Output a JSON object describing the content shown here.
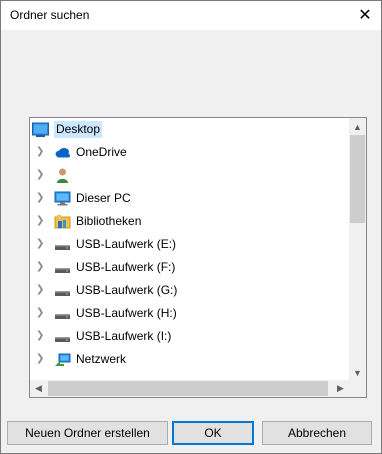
{
  "window": {
    "title": "Ordner suchen",
    "close_glyph": "✕"
  },
  "tree": {
    "items": [
      {
        "label": "Desktop",
        "icon": "desktop-icon",
        "selected": true,
        "expander": false
      },
      {
        "label": "OneDrive",
        "icon": "onedrive-cloud-icon",
        "expander": true
      },
      {
        "label": "",
        "icon": "user-icon",
        "expander": true
      },
      {
        "label": "Dieser PC",
        "icon": "computer-icon",
        "expander": true
      },
      {
        "label": "Bibliotheken",
        "icon": "libraries-icon",
        "expander": true
      },
      {
        "label": "USB-Laufwerk (E:)",
        "icon": "usb-drive-icon",
        "expander": true
      },
      {
        "label": "USB-Laufwerk (F:)",
        "icon": "usb-drive-icon",
        "expander": true
      },
      {
        "label": "USB-Laufwerk (G:)",
        "icon": "usb-drive-icon",
        "expander": true
      },
      {
        "label": "USB-Laufwerk (H:)",
        "icon": "usb-drive-icon",
        "expander": true
      },
      {
        "label": "USB-Laufwerk (I:)",
        "icon": "usb-drive-icon",
        "expander": true
      },
      {
        "label": "Netzwerk",
        "icon": "network-icon",
        "expander": true
      }
    ]
  },
  "buttons": {
    "new_folder": "Neuen Ordner erstellen",
    "ok": "OK",
    "cancel": "Abbrechen"
  },
  "colors": {
    "selection": "#cce8ff",
    "default_button_border": "#0078d7"
  }
}
